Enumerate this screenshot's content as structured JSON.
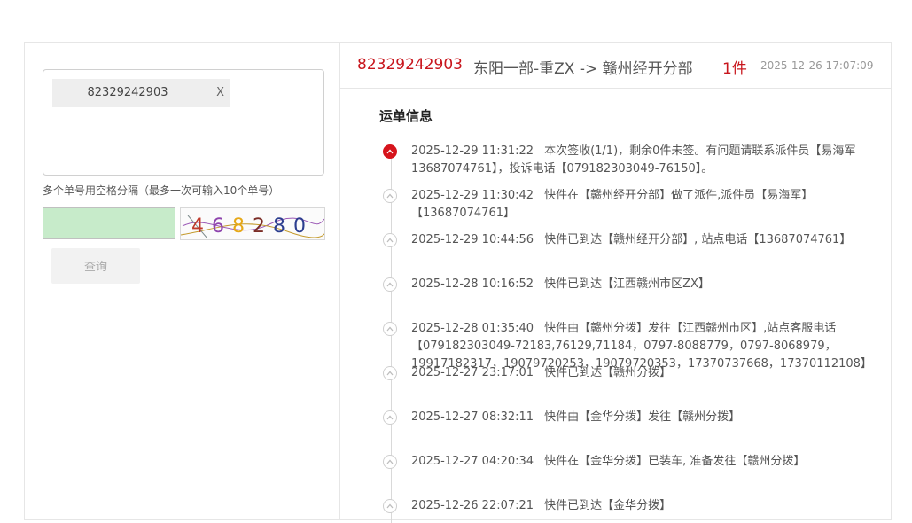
{
  "query_panel": {
    "tracking_tag": "82329242903",
    "tag_close": "X",
    "hint": "多个单号用空格分隔（最多一次可输入10个单号）",
    "captcha_chars": [
      "4",
      "6",
      "8",
      "2",
      "8",
      "0"
    ],
    "captcha_colors": [
      "#c0392b",
      "#8e44ad",
      "#e6a817",
      "#7b2d26",
      "#2c3e8f",
      "#2c3e8f"
    ],
    "query_button": "查询"
  },
  "header": {
    "tracking_number": "82329242903",
    "route": "东阳一部-重ZX -> 赣州经开分部",
    "count": "1件",
    "time": "2025-12-26 17:07:09"
  },
  "waybill": {
    "title": "运单信息",
    "events": [
      {
        "time": "2025-12-29 11:31:22",
        "desc": "本次签收(1/1)，剩余0件未签。有问题请联系派件员【易海军13687074761】，投诉电话【079182303049-76150】。"
      },
      {
        "time": "2025-12-29 11:30:42",
        "desc": "快件在【赣州经开分部】做了派件,派件员【易海军】【13687074761】"
      },
      {
        "time": "2025-12-29 10:44:56",
        "desc": "快件已到达【赣州经开分部】, 站点电话【13687074761】"
      },
      {
        "time": "2025-12-28 10:16:52",
        "desc": "快件已到达【江西赣州市区ZX】"
      },
      {
        "time": "2025-12-28 01:35:40",
        "desc": "快件由【赣州分拨】发往【江西赣州市区】,站点客服电话【079182303049-72183,76129,71184，0797-8088779，0797-8068979，19917182317，19079720253，19079720353，17370737668，17370112108】"
      },
      {
        "time": "2025-12-27 23:17:01",
        "desc": "快件已到达【赣州分拨】"
      },
      {
        "time": "2025-12-27 08:32:11",
        "desc": "快件由【金华分拨】发往【赣州分拨】"
      },
      {
        "time": "2025-12-27 04:20:34",
        "desc": "快件在【金华分拨】已装车, 准备发往【赣州分拨】"
      },
      {
        "time": "2025-12-26 22:07:21",
        "desc": "快件已到达【金华分拨】"
      }
    ]
  }
}
